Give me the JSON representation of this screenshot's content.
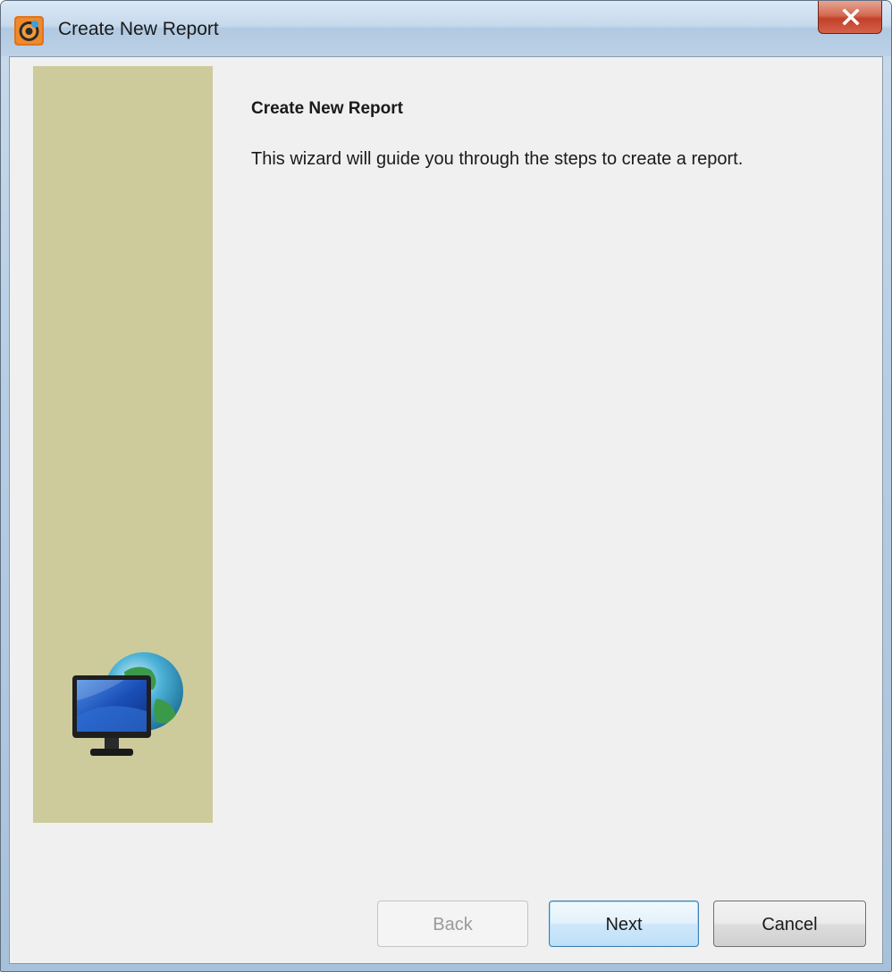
{
  "window": {
    "title": "Create New Report",
    "close_icon": "close-icon",
    "app_icon": "app-icon"
  },
  "wizard": {
    "heading": "Create New Report",
    "description": "This wizard will guide you through the steps to create a report.",
    "side_image": "monitor-globe-image"
  },
  "buttons": {
    "back_label": "Back",
    "next_label": "Next",
    "cancel_label": "Cancel",
    "back_enabled": false
  },
  "colors": {
    "side_panel": "#cdcb9b",
    "dialog_background": "#f0f0f0",
    "close_button": "#c7432c"
  }
}
